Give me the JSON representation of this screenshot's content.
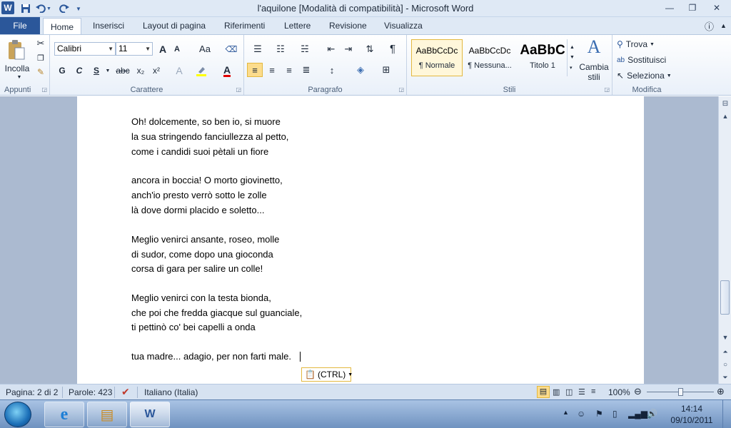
{
  "titlebar": {
    "title": "l'aquilone [Modalità di compatibilità]  -  Microsoft Word",
    "logo": "W",
    "qat_icons": [
      "save-icon",
      "undo-icon",
      "redo-icon",
      "customize-qat-icon"
    ],
    "controls": {
      "minimize": "—",
      "restore": "❐",
      "close": "✕"
    }
  },
  "tabs": {
    "file": "File",
    "items": [
      "Home",
      "Inserisci",
      "Layout di pagina",
      "Riferimenti",
      "Lettere",
      "Revisione",
      "Visualizza"
    ],
    "active": "Home"
  },
  "ribbon": {
    "clipboard": {
      "label": "Appunti",
      "paste": "Incolla"
    },
    "font": {
      "label": "Carattere",
      "family": "Calibri",
      "size": "11",
      "bold": "G",
      "italic": "C",
      "underline": "S",
      "strike": "abc",
      "subscript": "x₂",
      "superscript": "x²",
      "grow": "A",
      "shrink": "A",
      "case": "Aa"
    },
    "paragraph": {
      "label": "Paragrafo",
      "pilcrow": "¶"
    },
    "styles": {
      "label": "Stili",
      "items": [
        {
          "sample": "AaBbCcDc",
          "name": "¶ Normale"
        },
        {
          "sample": "AaBbCcDc",
          "name": "¶ Nessuna..."
        },
        {
          "sample": "AaBbC",
          "name": "Titolo 1"
        }
      ],
      "change_styles_line1": "Cambia",
      "change_styles_line2": "stili"
    },
    "editing": {
      "label": "Modifica",
      "find": "Trova",
      "replace": "Sostituisci",
      "select": "Seleziona"
    }
  },
  "document": {
    "lines": [
      "Oh! dolcemente, so ben io, si muore",
      "la sua stringendo fanciullezza al petto,",
      "come i candidi suoi pètali un fiore",
      "",
      "ancora in boccia! O morto giovinetto,",
      "anch'io presto verrò sotto le zolle",
      "là dove dormi placido e soletto...",
      "",
      "Meglio venirci ansante, roseo, molle",
      "di sudor, come dopo una gioconda",
      "corsa di gara per salire un colle!",
      "",
      "Meglio venirci con la testa bionda,",
      "che poi che fredda giacque sul guanciale,",
      "ti pettinò co' bei capelli a onda",
      "",
      "tua madre... adagio, per non farti male."
    ],
    "paste_options": "(CTRL)"
  },
  "status": {
    "page": "Pagina: 2 di 2",
    "words": "Parole: 423",
    "language": "Italiano (Italia)",
    "zoom": "100%",
    "zoom_fraction": 0.5
  },
  "taskbar": {
    "apps": [
      {
        "name": "internet-explorer",
        "glyph": "e"
      },
      {
        "name": "file-explorer",
        "glyph": "▤"
      },
      {
        "name": "microsoft-word",
        "glyph": "W"
      }
    ],
    "time": "14:14",
    "date": "09/10/2011"
  },
  "colors": {
    "accent": "#2b579a",
    "ribbon_bg": "#e9f0f9",
    "doc_bg": "#abbad0",
    "taskbar": "#6f92c0",
    "style_selected": "#fff7da"
  }
}
